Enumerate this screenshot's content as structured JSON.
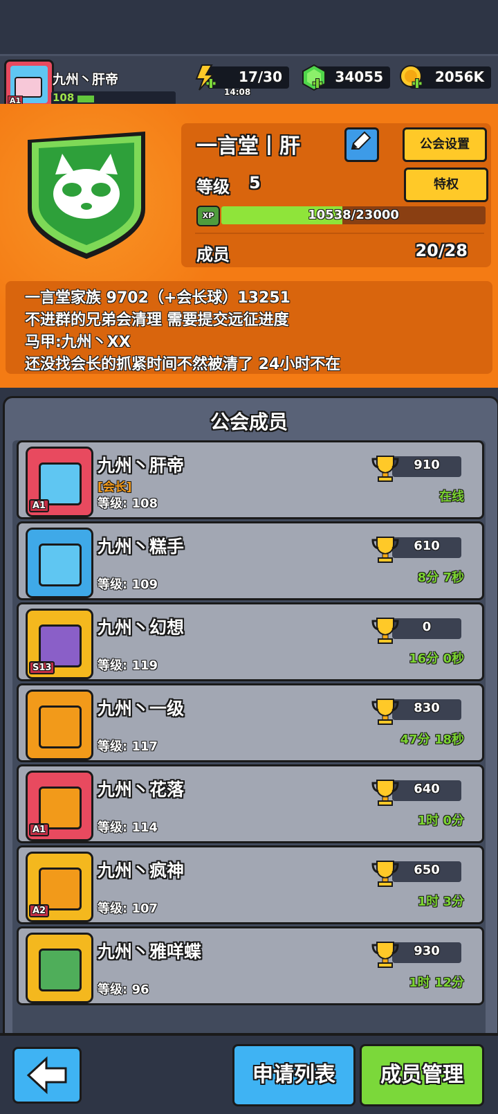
{
  "player": {
    "name": "九州丶肝帝",
    "level": "108",
    "avatar_tag": "A1"
  },
  "resources": {
    "energy": "17/30",
    "energy_timer": "14:08",
    "gems": "34055",
    "gold": "2056K"
  },
  "guild": {
    "name": "一言堂丨肝",
    "settings_label": "公会设置",
    "privilege_label": "特权",
    "level_label": "等级",
    "level_value": "5",
    "xp_label": "XP",
    "xp_text": "10538/23000",
    "xp_progress": 0.458,
    "members_label": "成员",
    "members_value": "20/28",
    "description": [
      "一言堂家族 9702（+会长球）13251",
      "不进群的兄弟会清理 需要提交远征进度",
      "马甲:九州丶XX",
      "还没找会长的抓紧时间不然被清了 24小时不在"
    ]
  },
  "members_title": "公会成员",
  "members": [
    {
      "name": "九州丶肝帝",
      "role": "[会长]",
      "level": "等级: 108",
      "score": "910",
      "status": "在线",
      "tag": "A1",
      "frame": "#e84a5f",
      "bg": "#5fc6f2"
    },
    {
      "name": "九州丶糕手",
      "role": "",
      "level": "等级: 109",
      "score": "610",
      "status": "8分 7秒",
      "tag": "",
      "frame": "#3fa9e8",
      "bg": "#5fc6f2"
    },
    {
      "name": "九州丶幻想",
      "role": "",
      "level": "等级: 119",
      "score": "0",
      "status": "16分 0秒",
      "tag": "S13",
      "frame": "#f4b81e",
      "bg": "#8a5fc8"
    },
    {
      "name": "九州丶一级",
      "role": "",
      "level": "等级: 117",
      "score": "830",
      "status": "47分 18秒",
      "tag": "",
      "frame": "#f29a1a",
      "bg": "#f29a1a"
    },
    {
      "name": "九州丶花落",
      "role": "",
      "level": "等级: 114",
      "score": "640",
      "status": "1时 0分",
      "tag": "A1",
      "frame": "#e84a5f",
      "bg": "#f29a1a"
    },
    {
      "name": "九州丶疯神",
      "role": "",
      "level": "等级: 107",
      "score": "650",
      "status": "1时 3分",
      "tag": "A2",
      "frame": "#f4b81e",
      "bg": "#f29a1a"
    },
    {
      "name": "九州丶雅咩蝶",
      "role": "",
      "level": "等级: 96",
      "score": "930",
      "status": "1时 12分",
      "tag": "",
      "frame": "#f4b81e",
      "bg": "#4fae5a"
    }
  ],
  "buttons": {
    "apply": "申请列表",
    "manage": "成员管理"
  },
  "colors": {
    "panel_orange": "#f47b14",
    "button_yellow": "#ffc928",
    "button_blue": "#3fb3f3",
    "button_green": "#7bd83a",
    "online_green": "#7cd432"
  }
}
